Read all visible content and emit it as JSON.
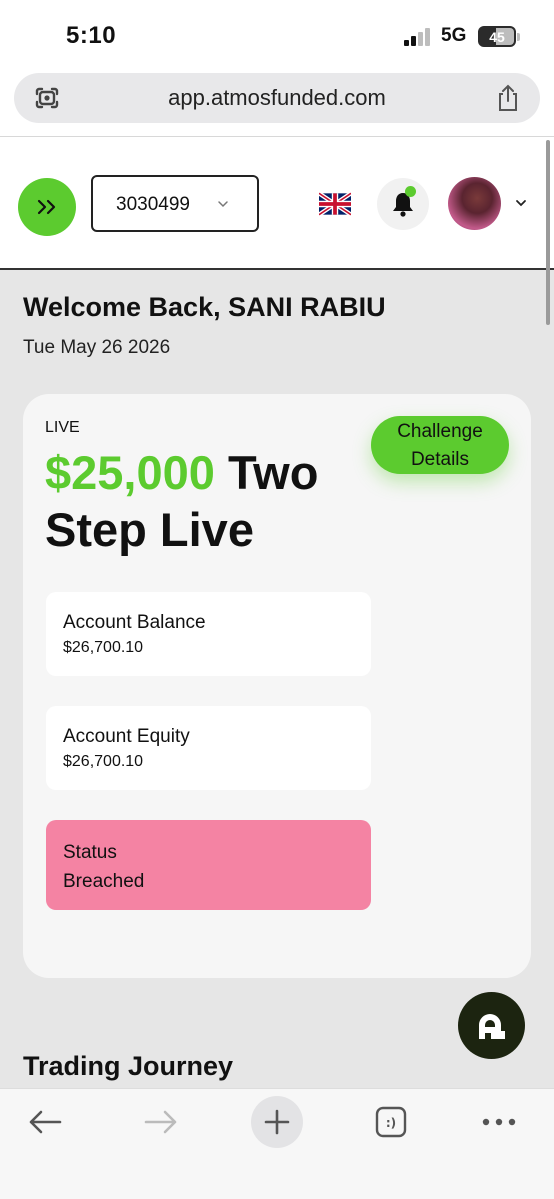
{
  "status_bar": {
    "time": "5:10",
    "network": "5G",
    "battery": "45"
  },
  "browser": {
    "url": "app.atmosfunded.com"
  },
  "header": {
    "account_id": "3030499"
  },
  "main": {
    "welcome": "Welcome Back, SANI RABIU",
    "date": "Tue May 26 2026",
    "card": {
      "tag": "LIVE",
      "title_amount": "$25,000",
      "title_rest": " Two Step Live",
      "challenge_button": "Challenge Details",
      "balance_label": "Account Balance",
      "balance_value": "$26,700.10",
      "equity_label": "Account Equity",
      "equity_value": "$26,700.10",
      "status_label": "Status",
      "status_value": "Breached"
    },
    "section_title": "Trading Journey"
  },
  "colors": {
    "accent": "#5ccb2f",
    "breached": "#f483a3",
    "background": "#e6e6e6"
  }
}
